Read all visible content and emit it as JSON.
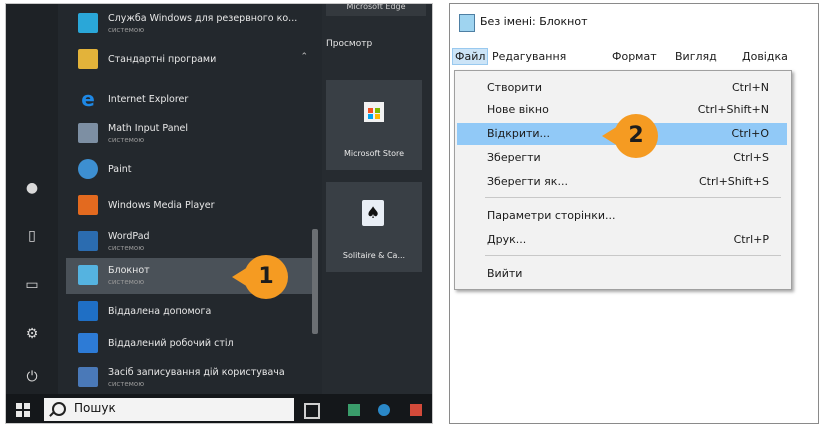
{
  "start_menu": {
    "apps": [
      {
        "name": "Служба Windows для резервного ко...",
        "sub": "системою",
        "icon": "backup-icon",
        "color": "#2aa7d8"
      },
      {
        "name": "Стандартні програми",
        "sub": "",
        "icon": "folder-icon",
        "color": "#e3b33a"
      },
      {
        "name": "Internet Explorer",
        "sub": "",
        "icon": "internet-explorer-icon",
        "color": "#1e88e5"
      },
      {
        "name": "Math Input Panel",
        "sub": "системою",
        "icon": "math-input-icon",
        "color": "#7d8fa3"
      },
      {
        "name": "Paint",
        "sub": "",
        "icon": "paint-icon",
        "color": "#3d8fd1"
      },
      {
        "name": "Windows Media Player",
        "sub": "",
        "icon": "media-player-icon",
        "color": "#e36a1f"
      },
      {
        "name": "WordPad",
        "sub": "системою",
        "icon": "wordpad-icon",
        "color": "#2b6cb0"
      },
      {
        "name": "Блокнот",
        "sub": "системою",
        "icon": "notepad-icon",
        "color": "#55b3e0"
      },
      {
        "name": "Віддалена допомога",
        "sub": "",
        "icon": "remote-assistance-icon",
        "color": "#1f6fc5"
      },
      {
        "name": "Віддалений робочий стіл",
        "sub": "",
        "icon": "remote-desktop-icon",
        "color": "#2d7bd6"
      },
      {
        "name": "Засіб записування дій користувача",
        "sub": "системою",
        "icon": "steps-recorder-icon",
        "color": "#4a79b8"
      }
    ],
    "tiles_group": "Просмотр",
    "tile_top": "Microsoft Edge",
    "tiles": [
      {
        "label": "Microsoft Store",
        "icon": "store-icon"
      },
      {
        "label": "Solitaire & Ca...",
        "icon": "solitaire-icon"
      }
    ],
    "search_text": "Пошук",
    "callout": "1"
  },
  "notepad": {
    "title": "Без імені: Блокнот",
    "menus": [
      "Файл",
      "Редагування",
      "Формат",
      "Вигляд",
      "Довідка"
    ],
    "items": [
      {
        "label": "Створити",
        "shortcut": "Ctrl+N"
      },
      {
        "label": "Нове вікно",
        "shortcut": "Ctrl+Shift+N"
      },
      {
        "label": "Відкрити...",
        "shortcut": "Ctrl+O"
      },
      {
        "label": "Зберегти",
        "shortcut": "Ctrl+S"
      },
      {
        "label": "Зберегти як...",
        "shortcut": "Ctrl+Shift+S"
      },
      {
        "label": "Параметри сторінки...",
        "shortcut": ""
      },
      {
        "label": "Друк...",
        "shortcut": "Ctrl+P"
      },
      {
        "label": "Вийти",
        "shortcut": ""
      }
    ],
    "callout": "2"
  },
  "colors": {
    "accent": "#f59b22",
    "highlight": "#91c9f7"
  }
}
